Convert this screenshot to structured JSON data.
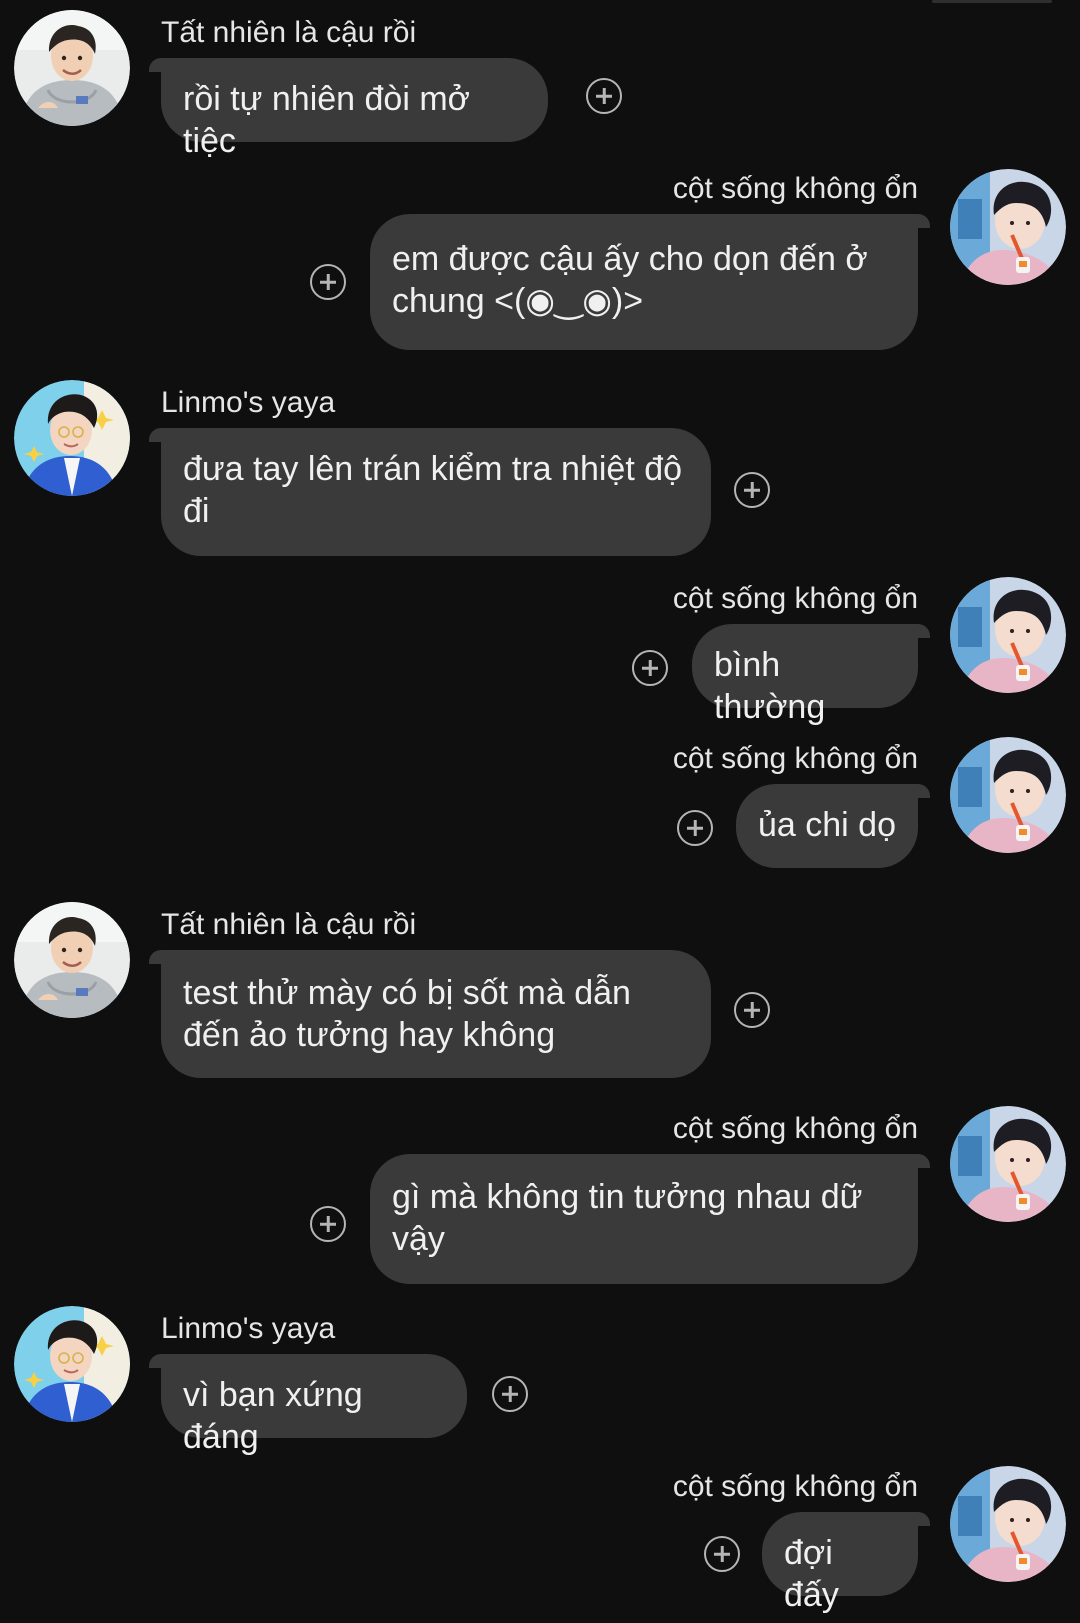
{
  "messages": [
    {
      "sender": "Tất nhiên là cậu rồi",
      "text": "rồi tự nhiên đòi mở tiệc",
      "avatar": "avatar-grey-hoodie"
    },
    {
      "sender": "cột sống không ổn",
      "text": "em được cậu ấy cho dọn đến ở chung <(◉‿◉)>",
      "avatar": "avatar-straw-drink"
    },
    {
      "sender": "Linmo's yaya",
      "text": "đưa tay lên trán kiểm tra nhiệt độ đi",
      "avatar": "avatar-blue-jacket"
    },
    {
      "sender": "cột sống không ổn",
      "text": "bình thường",
      "avatar": "avatar-straw-drink"
    },
    {
      "sender": "cột sống không ổn",
      "text": "ủa chi dọ",
      "avatar": "avatar-straw-drink"
    },
    {
      "sender": "Tất nhiên là cậu rồi",
      "text": "test thử mày có bị sốt mà dẫn đến ảo tưởng hay không",
      "avatar": "avatar-grey-hoodie"
    },
    {
      "sender": "cột sống không ổn",
      "text": "gì mà không tin tưởng nhau dữ vậy",
      "avatar": "avatar-straw-drink"
    },
    {
      "sender": "Linmo's yaya",
      "text": "vì bạn xứng đáng",
      "avatar": "avatar-blue-jacket"
    },
    {
      "sender": "cột sống không ổn",
      "text": "đợi đấy",
      "avatar": "avatar-straw-drink"
    }
  ],
  "colors": {
    "background": "#0f0f0f",
    "bubble": "#3a3a3a",
    "text": "#f0f0f0",
    "icon": "#b5b5b5"
  },
  "icons": {
    "reaction": "add-reaction-icon"
  }
}
